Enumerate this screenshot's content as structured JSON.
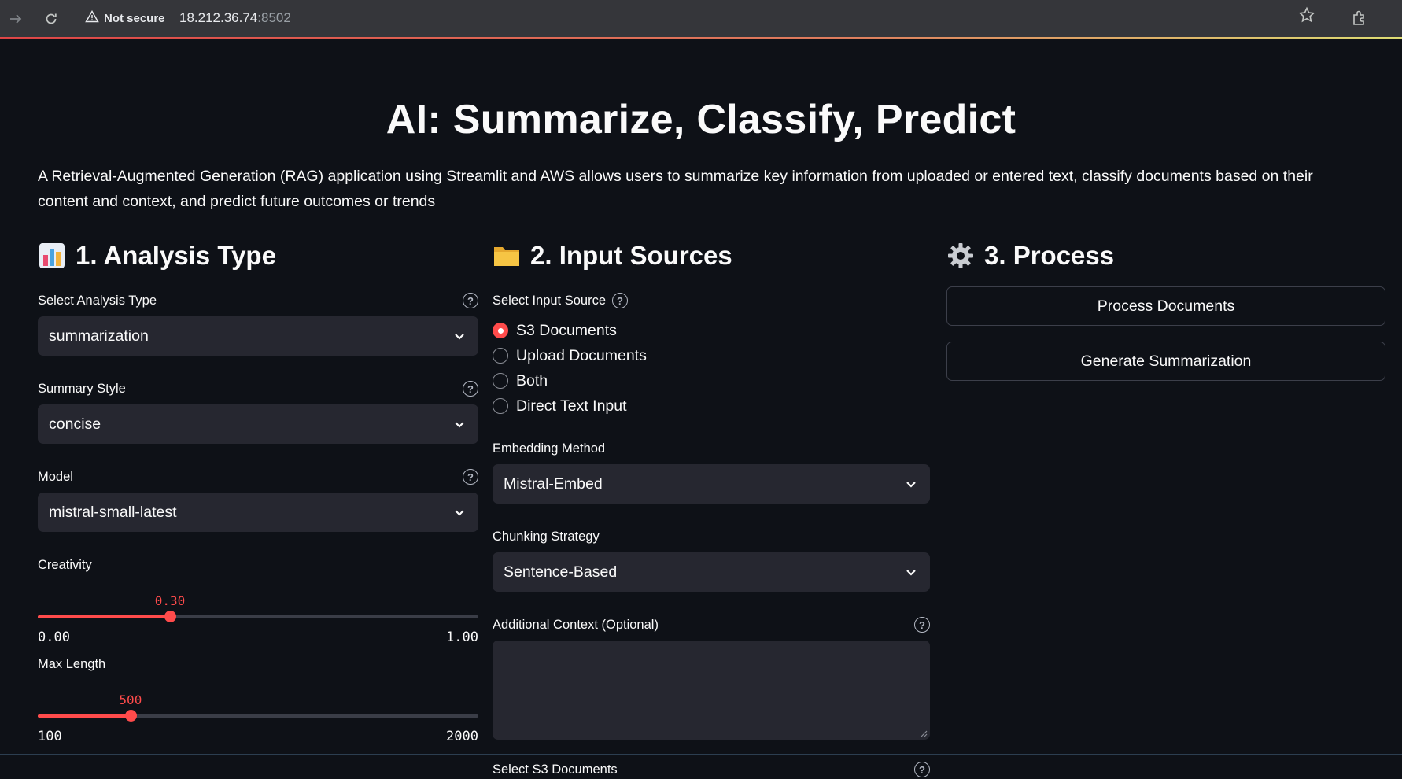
{
  "browser": {
    "security_label": "Not secure",
    "url_host": "18.212.36.74",
    "url_port": ":8502"
  },
  "page": {
    "title": "AI: Summarize, Classify, Predict",
    "description": "A Retrieval-Augmented Generation (RAG) application using Streamlit and AWS allows users to summarize key information from uploaded or entered text, classify documents based on their content and context, and predict future outcomes or trends"
  },
  "analysis": {
    "heading": "1. Analysis Type",
    "heading_icon": "bar-chart-icon",
    "analysis_type_label": "Select Analysis Type",
    "analysis_type_value": "summarization",
    "summary_style_label": "Summary Style",
    "summary_style_value": "concise",
    "model_label": "Model",
    "model_value": "mistral-small-latest",
    "creativity": {
      "label": "Creativity",
      "value": "0.30",
      "min": "0.00",
      "max": "1.00",
      "fraction": 0.3
    },
    "max_length": {
      "label": "Max Length",
      "value": "500",
      "min": "100",
      "max": "2000",
      "fraction": 0.2105
    }
  },
  "inputs": {
    "heading": "2. Input Sources",
    "heading_icon": "folder-icon",
    "source_label": "Select Input Source",
    "sources": [
      {
        "label": "S3 Documents",
        "selected": true
      },
      {
        "label": "Upload Documents",
        "selected": false
      },
      {
        "label": "Both",
        "selected": false
      },
      {
        "label": "Direct Text Input",
        "selected": false
      }
    ],
    "embedding_label": "Embedding Method",
    "embedding_value": "Mistral-Embed",
    "chunking_label": "Chunking Strategy",
    "chunking_value": "Sentence-Based",
    "context_label": "Additional Context (Optional)",
    "context_value": "",
    "s3_docs_label": "Select S3 Documents"
  },
  "process": {
    "heading": "3. Process",
    "heading_icon": "gear-icon",
    "process_button": "Process Documents",
    "generate_button": "Generate Summarization"
  },
  "colors": {
    "accent": "#ff4b4b",
    "background": "#0e1117",
    "input_bg": "#262730"
  }
}
